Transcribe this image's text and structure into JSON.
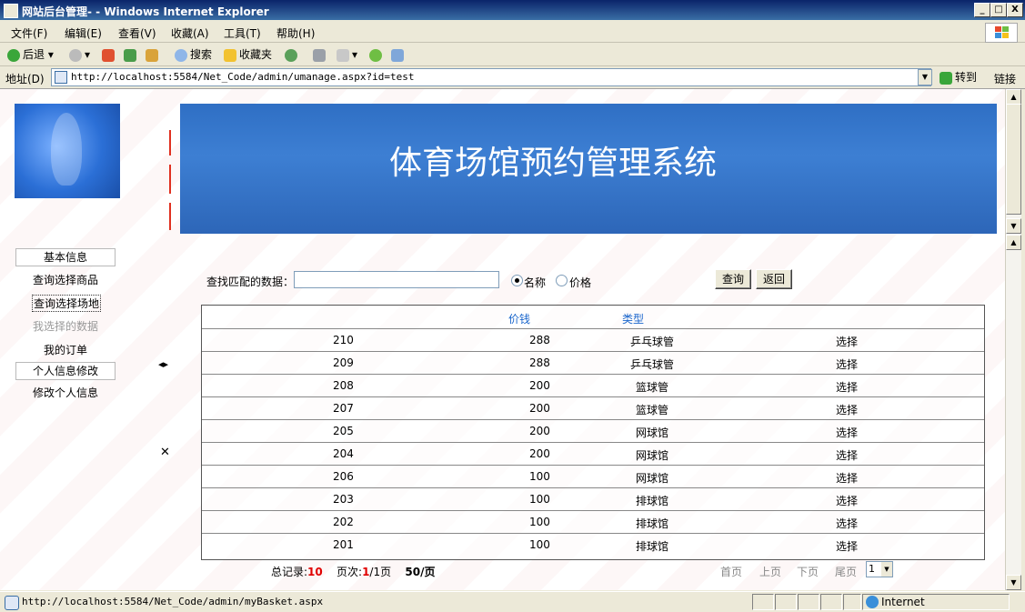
{
  "window": {
    "title": "网站后台管理- - Windows Internet Explorer",
    "minimize": "_",
    "maximize": "□",
    "close": "X"
  },
  "menu": [
    "文件(F)",
    "编辑(E)",
    "查看(V)",
    "收藏(A)",
    "工具(T)",
    "帮助(H)"
  ],
  "toolbar": {
    "back": "后退",
    "search": "搜索",
    "favorites": "收藏夹"
  },
  "address": {
    "label": "地址(D)",
    "url": "http://localhost:5584/Net_Code/admin/umanage.aspx?id=test",
    "go": "转到",
    "links": "链接"
  },
  "banner": {
    "title": "体育场馆预约管理系统"
  },
  "nav": {
    "section_basic": "基本信息",
    "query_goods": "查询选择商品",
    "query_venue": "查询选择场地",
    "my_selected": "我选择的数据",
    "my_orders": "我的订单",
    "section_profile": "个人信息修改",
    "edit_profile": "修改个人信息",
    "toggle_icon": "◂▸",
    "close_icon": "✕"
  },
  "search": {
    "label": "查找匹配的数据：",
    "value": "",
    "radio_name": "名称",
    "radio_price": "价格",
    "selected": "名称",
    "query_button": "查询",
    "back_button": "返回"
  },
  "table": {
    "columns": [
      "价钱",
      "类型"
    ],
    "rows": [
      {
        "id": "210",
        "price": "288",
        "type": "乒乓球管",
        "action": "选择"
      },
      {
        "id": "209",
        "price": "288",
        "type": "乒乓球管",
        "action": "选择"
      },
      {
        "id": "208",
        "price": "200",
        "type": "篮球管",
        "action": "选择"
      },
      {
        "id": "207",
        "price": "200",
        "type": "篮球管",
        "action": "选择"
      },
      {
        "id": "205",
        "price": "200",
        "type": "网球馆",
        "action": "选择"
      },
      {
        "id": "204",
        "price": "200",
        "type": "网球馆",
        "action": "选择"
      },
      {
        "id": "206",
        "price": "100",
        "type": "网球馆",
        "action": "选择"
      },
      {
        "id": "203",
        "price": "100",
        "type": "排球馆",
        "action": "选择"
      },
      {
        "id": "202",
        "price": "100",
        "type": "排球馆",
        "action": "选择"
      },
      {
        "id": "201",
        "price": "100",
        "type": "排球馆",
        "action": "选择"
      }
    ]
  },
  "pager": {
    "total_label": "总记录:",
    "total": "10",
    "page_label": "页次:",
    "current_page": "1",
    "page_sep": "/1页",
    "per_page": "50/页",
    "first": "首页",
    "prev": "上页",
    "next": "下页",
    "last": "尾页",
    "select_value": "1"
  },
  "status": {
    "url": "http://localhost:5584/Net_Code/admin/myBasket.aspx",
    "zone": "Internet"
  },
  "colors": {
    "title_bar": "#0a246a",
    "banner": "#2f6fc4",
    "header_link": "#1a66cc",
    "pager_red": "#e00000"
  }
}
